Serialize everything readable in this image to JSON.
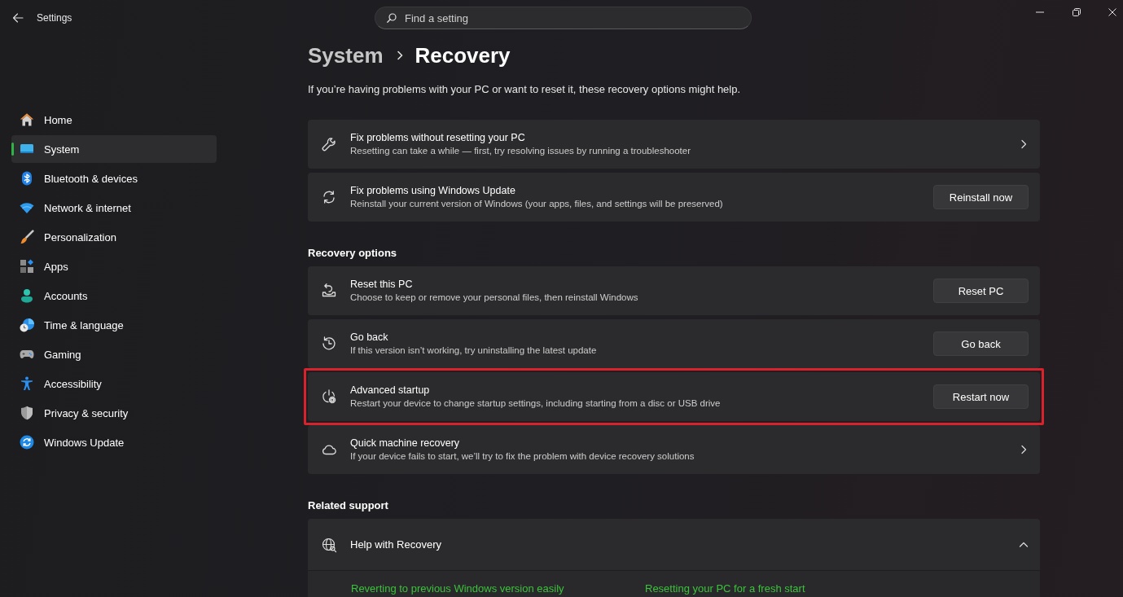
{
  "window": {
    "title": "Settings"
  },
  "search": {
    "placeholder": "Find a setting"
  },
  "sidebar": {
    "items": [
      {
        "label": "Home",
        "selected": false
      },
      {
        "label": "System",
        "selected": true
      },
      {
        "label": "Bluetooth & devices",
        "selected": false
      },
      {
        "label": "Network & internet",
        "selected": false
      },
      {
        "label": "Personalization",
        "selected": false
      },
      {
        "label": "Apps",
        "selected": false
      },
      {
        "label": "Accounts",
        "selected": false
      },
      {
        "label": "Time & language",
        "selected": false
      },
      {
        "label": "Gaming",
        "selected": false
      },
      {
        "label": "Accessibility",
        "selected": false
      },
      {
        "label": "Privacy & security",
        "selected": false
      },
      {
        "label": "Windows Update",
        "selected": false
      }
    ]
  },
  "breadcrumb": {
    "parent": "System",
    "current": "Recovery"
  },
  "description": "If you’re having problems with your PC or want to reset it, these recovery options might help.",
  "troubleshoot_cards": [
    {
      "kind": "link",
      "title": "Fix problems without resetting your PC",
      "subtitle": "Resetting can take a while — first, try resolving issues by running a troubleshooter",
      "highlighted": false
    },
    {
      "kind": "action",
      "title": "Fix problems using Windows Update",
      "subtitle": "Reinstall your current version of Windows (your apps, files, and settings will be preserved)",
      "button": "Reinstall now",
      "highlighted": false
    }
  ],
  "recovery_options": {
    "heading": "Recovery options",
    "cards": [
      {
        "kind": "action",
        "title": "Reset this PC",
        "subtitle": "Choose to keep or remove your personal files, then reinstall Windows",
        "button": "Reset PC",
        "highlighted": false
      },
      {
        "kind": "action",
        "title": "Go back",
        "subtitle": "If this version isn’t working, try uninstalling the latest update",
        "button": "Go back",
        "highlighted": false
      },
      {
        "kind": "action",
        "title": "Advanced startup",
        "subtitle": "Restart your device to change startup settings, including starting from a disc or USB drive",
        "button": "Restart now",
        "highlighted": true
      },
      {
        "kind": "link",
        "title": "Quick machine recovery",
        "subtitle": "If your device fails to start, we’ll try to fix the problem with device recovery solutions",
        "highlighted": false
      }
    ]
  },
  "related_support": {
    "heading": "Related support",
    "expander": {
      "title": "Help with Recovery",
      "expanded": true,
      "links": [
        "Reverting to previous Windows version easily",
        "Resetting your PC for a fresh start"
      ]
    }
  }
}
